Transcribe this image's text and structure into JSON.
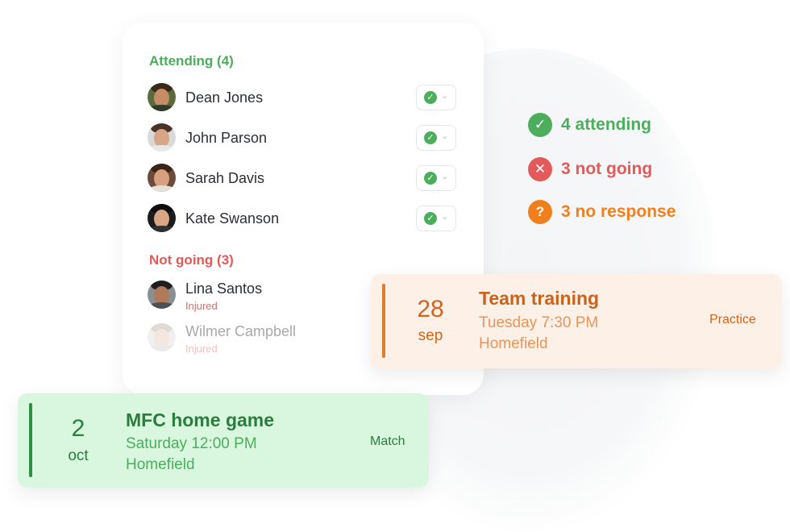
{
  "attending": {
    "title": "Attending (4)",
    "people": [
      {
        "name": "Dean Jones"
      },
      {
        "name": "John Parson"
      },
      {
        "name": "Sarah Davis"
      },
      {
        "name": "Kate Swanson"
      }
    ]
  },
  "not_going": {
    "title": "Not going (3)",
    "people": [
      {
        "name": "Lina Santos",
        "note": "Injured"
      },
      {
        "name": "Wilmer Campbell",
        "note": "Injured"
      }
    ]
  },
  "summary": {
    "attending": "4 attending",
    "not_going": "3 not going",
    "no_response": "3 no response"
  },
  "events": [
    {
      "day": "28",
      "month": "sep",
      "title": "Team training",
      "time": "Tuesday 7:30 PM",
      "location": "Homefield",
      "type": "Practice"
    },
    {
      "day": "2",
      "month": "oct",
      "title": "MFC home game",
      "time": "Saturday 12:00 PM",
      "location": "Homefield",
      "type": "Match"
    }
  ],
  "colors": {
    "attending": "#4cae5c",
    "not_going": "#e25a5a",
    "no_response": "#f0801e",
    "practice_card": "#fdf1e7",
    "match_card": "#d9f7df"
  },
  "icons": {
    "rsvp_status": "check-circle-icon",
    "rsvp_menu": "chevron-down-icon",
    "attending": "check-circle-icon",
    "not_going": "x-circle-icon",
    "no_response": "question-circle-icon"
  }
}
